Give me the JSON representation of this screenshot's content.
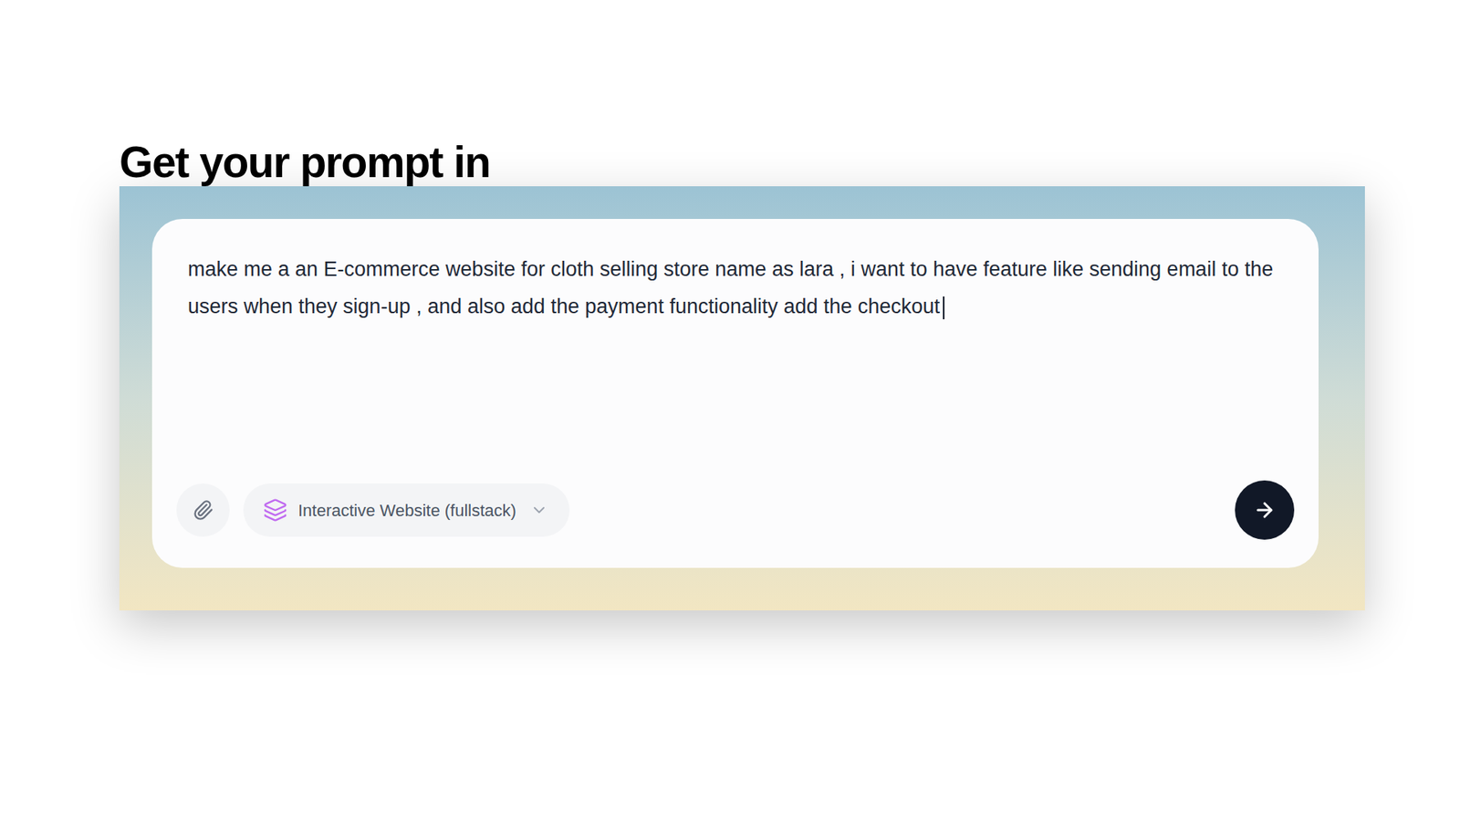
{
  "heading": "Get your prompt in",
  "prompt": {
    "value": "make me a an E-commerce website for cloth selling store name as lara , i want to have feature like sending email to the users when they sign-up , and also add the payment functionality add the checkout",
    "focused": true
  },
  "mode_select": {
    "label": "Interactive Website (fullstack)",
    "expanded": false
  }
}
